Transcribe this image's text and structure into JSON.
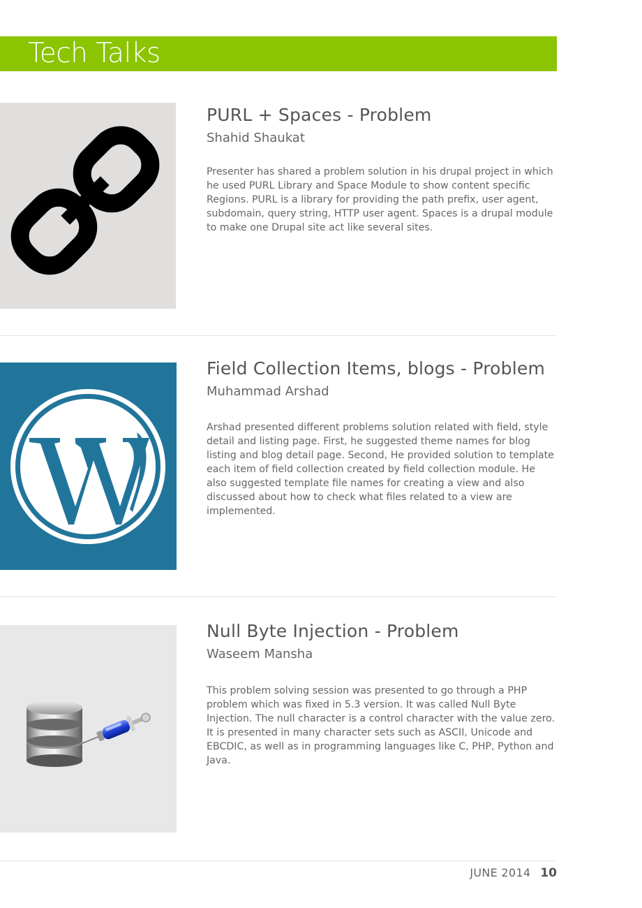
{
  "header": {
    "title": "Tech Talks",
    "bar_color": "#8bc400"
  },
  "articles": [
    {
      "title": "PURL + Spaces - Problem",
      "author": "Shahid Shaukat",
      "body": "Presenter has shared a problem solution in his drupal project in which he used PURL Library and Space Module to show content specific Regions. PURL is a library for providing the path prefix, user agent, subdomain, query string, HTTP user agent. Spaces is a drupal module to make one Drupal site act like several sites.",
      "image_icon": "chain-link-icon",
      "image_bg": "#e0dfdd"
    },
    {
      "title": "Field Collection Items, blogs - Problem",
      "author": "Muhammad Arshad",
      "body": "Arshad presented different problems solution related with field, style detail and listing page. First, he suggested theme names for blog listing and blog detail page. Second, He provided solution to template each item of field collection created by field collection module. He also suggested template file names for creating a view and also discussed about how to check what files related to a view are implemented.",
      "image_icon": "wordpress-logo-icon",
      "image_bg": "#21759b"
    },
    {
      "title": "Null Byte Injection - Problem",
      "author": "Waseem Mansha",
      "body": "This problem solving session was presented to go through a PHP problem which was fixed in 5.3 version. It was called Null Byte Injection. The null character is a control character with the value zero. It is presented in many character sets such as ASCII, Unicode and EBCDIC, as well as in programming languages like C, PHP, Python and Java.",
      "image_icon": "database-injection-icon",
      "image_bg": "#e8e8e8"
    }
  ],
  "footer": {
    "date": "JUNE 2014",
    "page_number": "10"
  }
}
